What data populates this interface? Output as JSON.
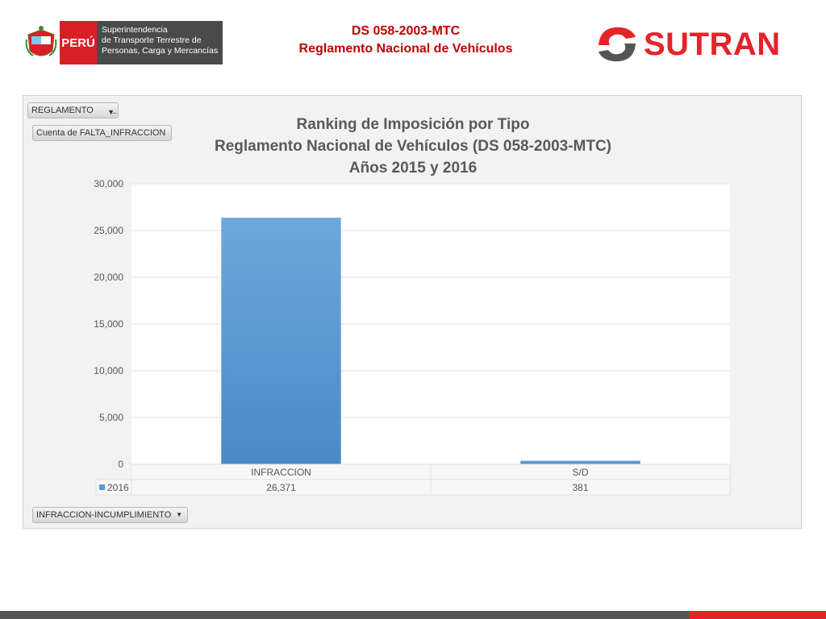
{
  "header": {
    "peru_label": "PERÚ",
    "institution_lines": [
      "Superintendencia",
      "de Transporte Terrestre de",
      "Personas, Carga y Mercancías"
    ],
    "title_line1": "DS 058-2003-MTC",
    "title_line2": "Reglamento Nacional de Vehículos",
    "brand": "SUTRAN"
  },
  "pivot": {
    "filter_field": "REGLAMENTO",
    "value_field": "Cuenta de FALTA_INFRACCION",
    "axis_field": "INFRACCION-INCUMPLIMIENTO"
  },
  "colors": {
    "bar": "#5b9bd5",
    "title": "#c00000",
    "brand": "#e3242b"
  },
  "chart_data": {
    "type": "bar",
    "title_lines": [
      "Ranking de Imposición por Tipo",
      "Reglamento Nacional de Vehículos (DS 058-2003-MTC)",
      "Años 2015 y 2016"
    ],
    "categories": [
      "INFRACCION",
      "S/D"
    ],
    "series": [
      {
        "name": "2016",
        "values": [
          26371,
          381
        ]
      }
    ],
    "data_labels": [
      "26,371",
      "381"
    ],
    "ylim": [
      0,
      30000
    ],
    "yticks": [
      0,
      5000,
      10000,
      15000,
      20000,
      25000,
      30000
    ],
    "ytick_labels": [
      "0",
      "5,000",
      "10,000",
      "15,000",
      "20,000",
      "25,000",
      "30,000"
    ],
    "grid": true,
    "data_table": true
  }
}
